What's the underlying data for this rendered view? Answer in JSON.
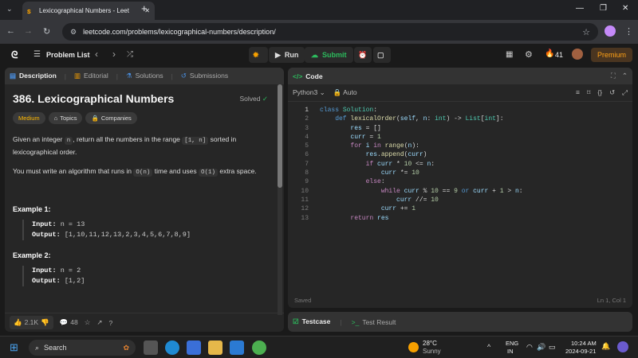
{
  "browser": {
    "tab_title": "Lexicographical Numbers - Leet",
    "url": "leetcode.com/problems/lexicographical-numbers/description/"
  },
  "header": {
    "problem_list": "Problem List",
    "run": "Run",
    "submit": "Submit",
    "streak": "41",
    "premium": "Premium"
  },
  "desc": {
    "tabs": [
      "Description",
      "Editorial",
      "Solutions",
      "Submissions"
    ],
    "title": "386. Lexicographical Numbers",
    "solved": "Solved",
    "difficulty": "Medium",
    "topics": "Topics",
    "companies": "Companies",
    "p1a": "Given an integer ",
    "n": "n",
    ", return all the numbers in the range ": "",
    "range": "[1, n]",
    "p1b": " sorted in lexicographical order.",
    "p2a": "You must write an algorithm that runs in ",
    "on": "O(n)",
    "p2b": " time and uses ",
    "o1": "O(1)",
    "p2c": " extra space.",
    "ex1_title": "Example 1:",
    "ex1_input_label": "Input:",
    "ex1_input": "n = 13",
    "ex1_output_label": "Output:",
    "ex1_output": "[1,10,11,12,13,2,3,4,5,6,7,8,9]",
    "ex2_title": "Example 2:",
    "ex2_input_label": "Input:",
    "ex2_input": "n = 2",
    "ex2_output_label": "Output:",
    "ex2_output": "[1,2]",
    "likes": "2.1K",
    "comments": "48"
  },
  "code": {
    "title": "Code",
    "lang": "Python3",
    "auto": "Auto",
    "saved": "Saved",
    "cursor": "Ln 1, Col 1"
  },
  "bottom": {
    "testcase": "Testcase",
    "result": "Test Result"
  },
  "taskbar": {
    "search": "Search",
    "weather_temp": "28°C",
    "weather": "Sunny",
    "lang1": "ENG",
    "lang2": "IN",
    "time": "10:24 AM",
    "date": "2024-09-21"
  }
}
